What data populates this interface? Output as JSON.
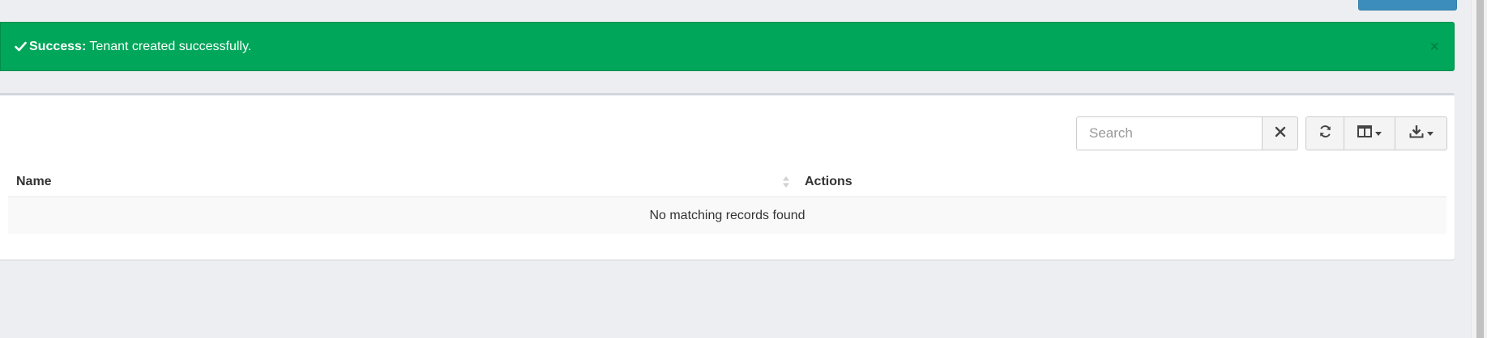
{
  "alert": {
    "title": "Success:",
    "message": "Tenant created successfully.",
    "close_symbol": "×",
    "color": "#00a65a"
  },
  "toolbar": {
    "search_placeholder": "Search",
    "clear_icon": "close-icon",
    "refresh_icon": "refresh-icon",
    "columns_icon": "columns-icon",
    "export_icon": "download-icon"
  },
  "table": {
    "columns": [
      "Name",
      "Actions"
    ],
    "empty_message": "No matching records found"
  }
}
